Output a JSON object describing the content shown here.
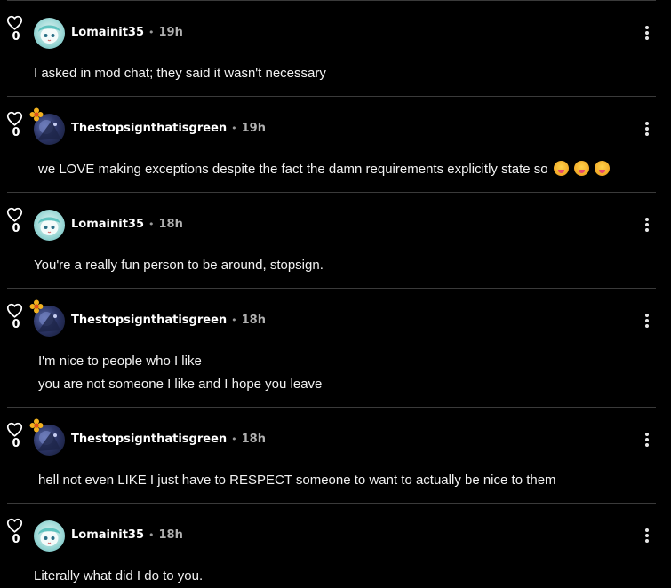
{
  "comments": [
    {
      "likes": "0",
      "user": "Lomainit35",
      "time": "19h",
      "avatar": "lomainit-avatar",
      "badge": false,
      "lines": [
        "I asked in mod chat; they said it wasn't necessary"
      ]
    },
    {
      "likes": "0",
      "user": "Thestopsignthatisgreen",
      "time": "19h",
      "avatar": "stopsign-avatar",
      "badge": true,
      "lines": [
        "we LOVE making exceptions despite the fact the damn requirements explicitly state so"
      ],
      "emoji_count": 3,
      "emoji_name": "money-mouth-face-emoji"
    },
    {
      "likes": "0",
      "user": "Lomainit35",
      "time": "18h",
      "avatar": "lomainit-avatar",
      "badge": false,
      "lines": [
        "You're a really fun person to be around, stopsign."
      ]
    },
    {
      "likes": "0",
      "user": "Thestopsignthatisgreen",
      "time": "18h",
      "avatar": "stopsign-avatar",
      "badge": true,
      "lines": [
        "I'm nice to people who I like",
        "you are not someone I like and I hope you leave"
      ]
    },
    {
      "likes": "0",
      "user": "Thestopsignthatisgreen",
      "time": "18h",
      "avatar": "stopsign-avatar",
      "badge": true,
      "lines": [
        "hell not even LIKE I just have to RESPECT someone to want to actually be nice to them"
      ]
    },
    {
      "likes": "0",
      "user": "Lomainit35",
      "time": "18h",
      "avatar": "lomainit-avatar",
      "badge": false,
      "lines": [
        "Literally what did I do to you."
      ]
    }
  ],
  "separator": "•",
  "icons": {
    "like": "heart-outline-icon",
    "menu": "more-vertical-icon",
    "badge": "flower-badge-icon"
  },
  "colors": {
    "background": "#000000",
    "text": "#f2f2f2",
    "muted": "#b0b0b0",
    "divider": "#3a3a3a"
  }
}
